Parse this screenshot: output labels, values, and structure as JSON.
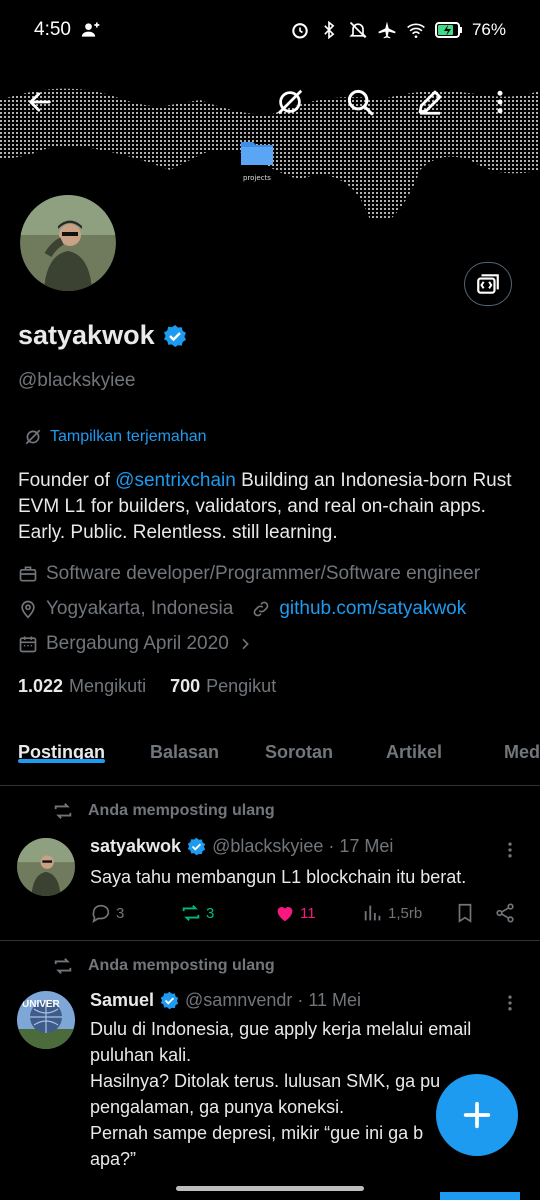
{
  "status_bar": {
    "time": "4:50",
    "battery": "76%"
  },
  "banner": {
    "folder_label": "projects"
  },
  "profile": {
    "name": "satyakwok",
    "handle": "@blackskyiee",
    "translate_label": "Tampilkan terjemahan",
    "bio_prefix": "Founder of ",
    "bio_mention": "@sentrixchain",
    "bio_rest": "  Building an Indonesia-born Rust EVM L1 for builders, validators, and real on-chain apps.  Early. Public. Relentless.  still learning.",
    "profession": "Software developer/Programmer/Software engineer",
    "location": "Yogyakarta, Indonesia",
    "website": "github.com/satyakwok",
    "joined": "Bergabung April 2020",
    "following_count": "1.022",
    "following_label": "Mengikuti",
    "followers_count": "700",
    "followers_label": "Pengikut"
  },
  "tabs": [
    "Postingan",
    "Balasan",
    "Sorotan",
    "Artikel",
    "Media"
  ],
  "posts": [
    {
      "repost_label": "Anda memposting ulang",
      "name": "satyakwok",
      "handle_date": "@blackskyiee · 17 Mei",
      "text": "Saya tahu membangun L1 blockchain itu berat.",
      "replies": "3",
      "reposts": "3",
      "likes": "11",
      "views": "1,5rb"
    },
    {
      "repost_label": "Anda memposting ulang",
      "name": "Samuel",
      "handle_date": "@samnvendr · 11 Mei",
      "line1": "Dulu di Indonesia, gue apply kerja melalui email puluhan kali.",
      "line2": "Hasilnya? Ditolak terus. lulusan SMK, ga pu",
      "line3": "pengalaman, ga punya koneksi.",
      "line4": "Pernah sampe depresi, mikir “gue ini ga b",
      "line5": "apa?”"
    }
  ],
  "colors": {
    "accent": "#1d9bf0",
    "like": "#f91880",
    "repost": "#00ba7c",
    "muted": "#71767b"
  }
}
